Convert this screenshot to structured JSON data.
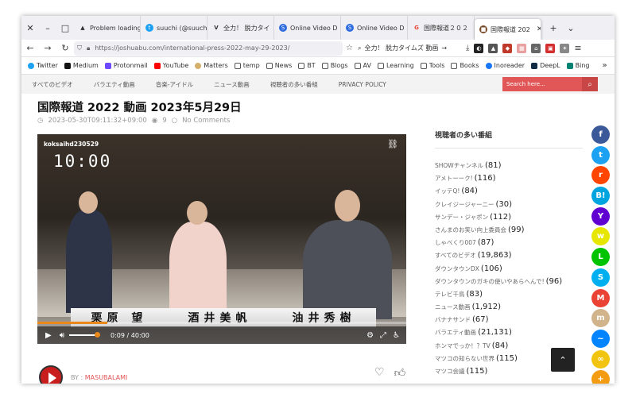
{
  "tabs": [
    {
      "label": "Problem loading",
      "icon": "warning-icon"
    },
    {
      "label": "suuchi (@suuchi",
      "icon": "twitter-icon"
    },
    {
      "label": "全力！ 脱力タイ",
      "icon": "v-logo-icon"
    },
    {
      "label": "Online Video D",
      "icon": "s-logo-icon"
    },
    {
      "label": "Online Video D",
      "icon": "s-logo-icon"
    },
    {
      "label": "国際報道２０２",
      "icon": "google-icon"
    },
    {
      "label": "国際報道 202",
      "icon": "site-icon",
      "active": true
    }
  ],
  "nav": {
    "url": "https://joshuabu.com/international-press-2022-may-29-2023/",
    "search_text": "全力！ 脱力タイムズ 動画"
  },
  "bookmarks": [
    "Twitter",
    "Medium",
    "Protonmail",
    "YouTube",
    "Matters",
    "temp",
    "News",
    "BT",
    "Blogs",
    "AV",
    "Learning",
    "Tools",
    "Books",
    "Inoreader",
    "DeepL",
    "Bing"
  ],
  "menu": [
    "すべてのビデオ",
    "バラエティ動画",
    "音楽-アイドル",
    "ニュース動画",
    "視聴者の多い番組",
    "PRIVACY POLICY"
  ],
  "site_search_placeholder": "Search here...",
  "post": {
    "title": "国際報道 2022 動画 2023年5月29日",
    "date": "2023-05-30T09:11:32+09:00",
    "views": "9",
    "comments": "No Comments",
    "author_prefix": "BY :",
    "author": "MASUBALAMI"
  },
  "video": {
    "label": "koksaihd230529",
    "clock": "10:00",
    "names": [
      "栗原 望",
      "酒井美帆",
      "油井秀樹"
    ],
    "time": "0:09 / 40:00",
    "progress": 0.004
  },
  "sidebar": {
    "title": "視聴者の多い番組",
    "items": [
      {
        "name": "SHOWチャンネル",
        "count": "(81)"
      },
      {
        "name": "アメトーーク!",
        "count": "(116)"
      },
      {
        "name": "イッテQ!",
        "count": "(84)"
      },
      {
        "name": "クレイジージャーニー",
        "count": "(30)"
      },
      {
        "name": "サンデー・ジャポン",
        "count": "(112)"
      },
      {
        "name": "さんまのお笑い向上委員会",
        "count": "(99)"
      },
      {
        "name": "しゃべくり007",
        "count": "(87)"
      },
      {
        "name": "すべてのビデオ",
        "count": "(19,863)"
      },
      {
        "name": "ダウンタウンDX",
        "count": "(106)"
      },
      {
        "name": "ダウンタウンのガキの使いやあらへんで!",
        "count": "(96)"
      },
      {
        "name": "テレビ千鳥",
        "count": "(83)"
      },
      {
        "name": "ニュース動画",
        "count": "(1,912)"
      },
      {
        "name": "バナナサンド",
        "count": "(67)"
      },
      {
        "name": "バラエティ動画",
        "count": "(21,131)"
      },
      {
        "name": "ホンマでっか！？TV",
        "count": "(84)"
      },
      {
        "name": "マツコの知らない世界",
        "count": "(115)"
      },
      {
        "name": "マツコ会議",
        "count": "(115)"
      }
    ]
  },
  "share": [
    {
      "icon": "facebook-icon",
      "glyph": "f",
      "color": "#3b5998"
    },
    {
      "icon": "twitter-icon",
      "glyph": "t",
      "color": "#1da1f2"
    },
    {
      "icon": "reddit-icon",
      "glyph": "r",
      "color": "#ff4500"
    },
    {
      "icon": "hatena-icon",
      "glyph": "B!",
      "color": "#00a4de"
    },
    {
      "icon": "yahoo-icon",
      "glyph": "Y",
      "color": "#5f01d1"
    },
    {
      "icon": "weibo-icon",
      "glyph": "w",
      "color": "#e6e600"
    },
    {
      "icon": "line-icon",
      "glyph": "L",
      "color": "#00c300"
    },
    {
      "icon": "skype-icon",
      "glyph": "S",
      "color": "#00aff0"
    },
    {
      "icon": "gmail-icon",
      "glyph": "M",
      "color": "#ea4335"
    },
    {
      "icon": "mix-icon",
      "glyph": "m",
      "color": "#d2b48c"
    },
    {
      "icon": "messenger-icon",
      "glyph": "~",
      "color": "#0084ff"
    },
    {
      "icon": "copy-link-icon",
      "glyph": "∞",
      "color": "#f1c40f"
    },
    {
      "icon": "more-icon",
      "glyph": "+",
      "color": "#f39c12"
    }
  ]
}
